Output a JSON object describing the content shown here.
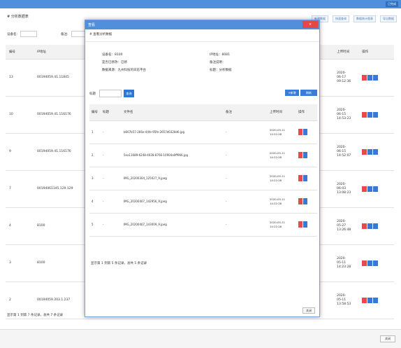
{
  "topbar": {
    "button": "已完成"
  },
  "page": {
    "title": "# 分析数据表",
    "links": [
      "新建数据",
      "快速查询",
      "数据统计图表",
      "导出数据"
    ],
    "filter": {
      "label1": "设备名:",
      "label2": "备注:"
    },
    "table": {
      "headers": [
        "编号",
        "IP地址",
        "",
        "上传时间",
        "操作"
      ],
      "rows": [
        {
          "no": "13",
          "id": "00194059.41.11845",
          "time": [
            "2020-",
            "06-17",
            "09:12:36"
          ]
        },
        {
          "no": "10",
          "id": "00194059.41.116176",
          "time": [
            "2020-",
            "06-15",
            "14:53:23"
          ]
        },
        {
          "no": "9",
          "id": "00194059.41.116176",
          "time": [
            "2020-",
            "06-15",
            "14:52:07"
          ]
        },
        {
          "no": "7",
          "id": "00194061145.129.129",
          "time": [
            "2020-",
            "06-03",
            "13:08:23"
          ]
        },
        {
          "no": "4",
          "id": "8100",
          "time": [
            "2020-",
            "05-27",
            "13:26:48"
          ]
        },
        {
          "no": "3",
          "id": "8100",
          "time": [
            "2020-",
            "05-11",
            "14:23:28"
          ]
        },
        {
          "no": "2",
          "id": "00194059.203.1.237",
          "time": [
            "2020-",
            "05-11",
            "13:58:53"
          ]
        }
      ]
    },
    "footer": "显示第 1 到第 7 条记录，总共 7 条记录",
    "close": "关闭"
  },
  "modal": {
    "title": "查看",
    "close_x": "×",
    "crumb": "# 查看分析数据",
    "info": [
      {
        "left": "设备名：8100",
        "right": "IP地址：8081"
      },
      {
        "left": "是否已修改：已修",
        "right": "备注说明："
      },
      {
        "left": "数据来源：九州科技的日志平台",
        "right": "标题：分析数据"
      }
    ],
    "query": {
      "label": "标题",
      "button": "查询",
      "add": "+新增",
      "refresh": "刷新"
    },
    "table": {
      "headers": [
        "编号",
        "标题",
        "文件名",
        "备注",
        "上传时间",
        "操作"
      ],
      "rows": [
        {
          "no": "1",
          "title": "-",
          "file": "b667b57-266e-44fe-95fe-2657d0328d6.jpg",
          "note": "-",
          "time": [
            "2020-05-11",
            "14:22:28"
          ]
        },
        {
          "no": "2",
          "title": "-",
          "file": "5ea11689-6248-4028-8766-10904a0ff966.jpg",
          "note": "-",
          "time": [
            "2020-05-11",
            "14:22:28"
          ]
        },
        {
          "no": "3",
          "title": "-",
          "file": "IMG_20200304_125027_9.jpeg",
          "note": "-",
          "time": [
            "2020-05-11",
            "14:22:28"
          ]
        },
        {
          "no": "4",
          "title": "-",
          "file": "IMG_20200407_142956_9.jpeg",
          "note": "-",
          "time": [
            "2020-05-11",
            "14:22:28"
          ]
        },
        {
          "no": "5",
          "title": "-",
          "file": "IMG_20200407_143009_9.jpeg",
          "note": "-",
          "time": [
            "2020-05-11",
            "14:22:28"
          ]
        }
      ]
    },
    "summary": "显示第 1 到第 5 条记录，总共 5 条记录",
    "close": "关闭"
  }
}
